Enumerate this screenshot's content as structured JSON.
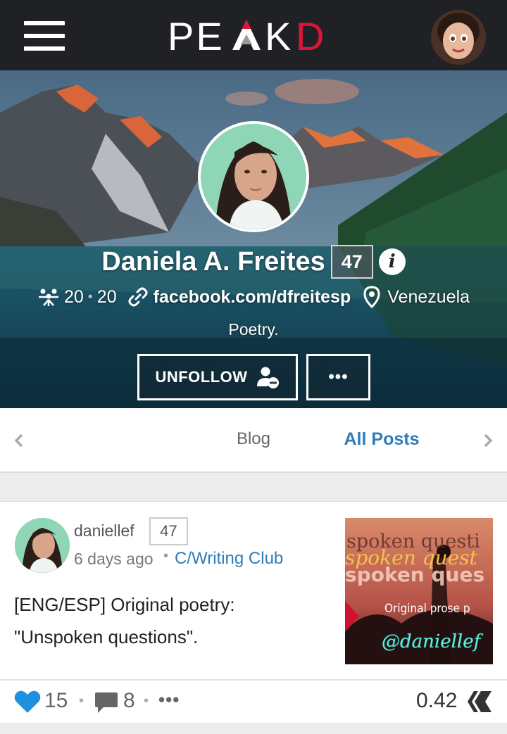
{
  "header": {
    "logo_text": "PEAKD",
    "logo_accent_color": "#e31337",
    "menu_icon": "hamburger-icon",
    "user_avatar": "user-avatar"
  },
  "profile": {
    "name": "Daniela A. Freites",
    "reputation": "47",
    "followers": "20",
    "following": "20",
    "website": "facebook.com/dfreitesp",
    "location": "Venezuela",
    "bio": "Poetry.",
    "unfollow_label": "UNFOLLOW",
    "more_label": "•••"
  },
  "tabs": {
    "items": [
      {
        "label": "Blog",
        "active": false
      },
      {
        "label": "All Posts",
        "active": true
      }
    ],
    "active_color": "#2f7cb8"
  },
  "post": {
    "author": "daniellef",
    "reputation": "47",
    "time": "6 days ago",
    "separator": "•",
    "community": "C/Writing Club",
    "title": "[ENG/ESP] Original poetry: \"Unspoken questions\".",
    "likes": "15",
    "comments": "8",
    "more": "•••",
    "payout": "0.42",
    "thumb_text": {
      "line1": "spoken questi",
      "line2": "spoken quest",
      "line3": "spoken ques",
      "subtitle": "Original prose p",
      "handle": "@daniellef"
    }
  }
}
